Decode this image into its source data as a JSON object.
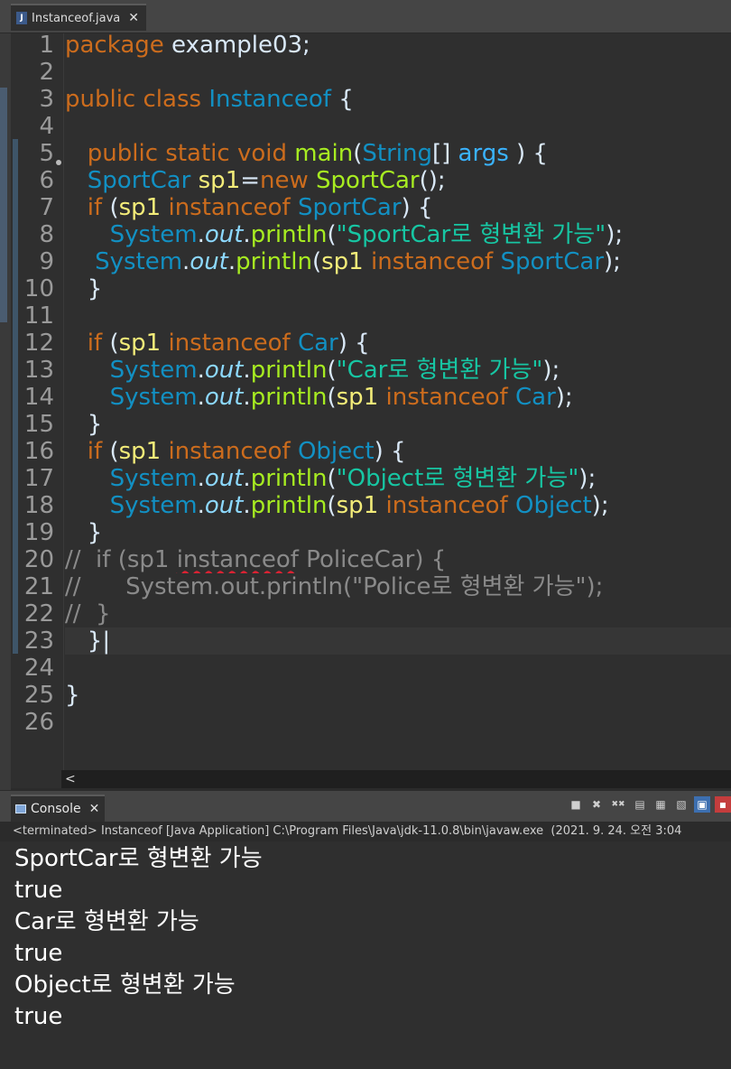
{
  "editor": {
    "tab_label": "Instanceof.java",
    "file_icon": "J",
    "lines": [
      {
        "n": "1",
        "tokens": [
          [
            "kw",
            "package "
          ],
          [
            "",
            "example03;"
          ]
        ]
      },
      {
        "n": "2",
        "tokens": []
      },
      {
        "n": "3",
        "tokens": [
          [
            "kw",
            "public "
          ],
          [
            "kw",
            "class "
          ],
          [
            "cls",
            "Instanceof"
          ],
          [
            "",
            " {"
          ]
        ]
      },
      {
        "n": "4",
        "tokens": []
      },
      {
        "n": "5",
        "tokens": [
          [
            "",
            "   "
          ],
          [
            "kw",
            "public "
          ],
          [
            "kw",
            "static "
          ],
          [
            "kw",
            "void "
          ],
          [
            "fn",
            "main"
          ],
          [
            "",
            "("
          ],
          [
            "cls",
            "String"
          ],
          [
            "",
            "[] "
          ],
          [
            "fld",
            "args"
          ],
          [
            "",
            " ) {"
          ]
        ]
      },
      {
        "n": "6",
        "tokens": [
          [
            "",
            "   "
          ],
          [
            "cls",
            "SportCar "
          ],
          [
            "var",
            "sp1"
          ],
          [
            "",
            "="
          ],
          [
            "kw",
            "new "
          ],
          [
            "fn",
            "SportCar"
          ],
          [
            "",
            "();"
          ]
        ]
      },
      {
        "n": "7",
        "tokens": [
          [
            "",
            "   "
          ],
          [
            "kw",
            "if "
          ],
          [
            "",
            "("
          ],
          [
            "var",
            "sp1 "
          ],
          [
            "kw",
            "instanceof "
          ],
          [
            "cls",
            "SportCar"
          ],
          [
            "",
            ") {"
          ]
        ]
      },
      {
        "n": "8",
        "tokens": [
          [
            "",
            "      "
          ],
          [
            "cls",
            "System"
          ],
          [
            "",
            "."
          ],
          [
            "out",
            "out"
          ],
          [
            "",
            "."
          ],
          [
            "fn",
            "println"
          ],
          [
            "",
            "("
          ],
          [
            "str",
            "\"SportCar로 형변환 가능\""
          ],
          [
            "",
            ");"
          ]
        ]
      },
      {
        "n": "9",
        "tokens": [
          [
            "",
            "    "
          ],
          [
            "cls",
            "System"
          ],
          [
            "",
            "."
          ],
          [
            "out",
            "out"
          ],
          [
            "",
            "."
          ],
          [
            "fn",
            "println"
          ],
          [
            "",
            "("
          ],
          [
            "var",
            "sp1 "
          ],
          [
            "kw",
            "instanceof "
          ],
          [
            "cls",
            "SportCar"
          ],
          [
            "",
            ");"
          ]
        ]
      },
      {
        "n": "10",
        "tokens": [
          [
            "",
            "   }"
          ]
        ]
      },
      {
        "n": "11",
        "tokens": []
      },
      {
        "n": "12",
        "tokens": [
          [
            "",
            "   "
          ],
          [
            "kw",
            "if "
          ],
          [
            "",
            "("
          ],
          [
            "var",
            "sp1 "
          ],
          [
            "kw",
            "instanceof "
          ],
          [
            "cls",
            "Car"
          ],
          [
            "",
            ") {"
          ]
        ]
      },
      {
        "n": "13",
        "tokens": [
          [
            "",
            "      "
          ],
          [
            "cls",
            "System"
          ],
          [
            "",
            "."
          ],
          [
            "out",
            "out"
          ],
          [
            "",
            "."
          ],
          [
            "fn",
            "println"
          ],
          [
            "",
            "("
          ],
          [
            "str",
            "\"Car로 형변환 가능\""
          ],
          [
            "",
            ");"
          ]
        ]
      },
      {
        "n": "14",
        "tokens": [
          [
            "",
            "      "
          ],
          [
            "cls",
            "System"
          ],
          [
            "",
            "."
          ],
          [
            "out",
            "out"
          ],
          [
            "",
            "."
          ],
          [
            "fn",
            "println"
          ],
          [
            "",
            "("
          ],
          [
            "var",
            "sp1 "
          ],
          [
            "kw",
            "instanceof "
          ],
          [
            "cls",
            "Car"
          ],
          [
            "",
            ");"
          ]
        ]
      },
      {
        "n": "15",
        "tokens": [
          [
            "",
            "   }"
          ]
        ]
      },
      {
        "n": "16",
        "tokens": [
          [
            "",
            "   "
          ],
          [
            "kw",
            "if "
          ],
          [
            "",
            "("
          ],
          [
            "var",
            "sp1 "
          ],
          [
            "kw",
            "instanceof "
          ],
          [
            "cls",
            "Object"
          ],
          [
            "",
            ") {"
          ]
        ]
      },
      {
        "n": "17",
        "tokens": [
          [
            "",
            "      "
          ],
          [
            "cls",
            "System"
          ],
          [
            "",
            "."
          ],
          [
            "out",
            "out"
          ],
          [
            "",
            "."
          ],
          [
            "fn",
            "println"
          ],
          [
            "",
            "("
          ],
          [
            "str",
            "\"Object로 형변환 가능\""
          ],
          [
            "",
            ");"
          ]
        ]
      },
      {
        "n": "18",
        "tokens": [
          [
            "",
            "      "
          ],
          [
            "cls",
            "System"
          ],
          [
            "",
            "."
          ],
          [
            "out",
            "out"
          ],
          [
            "",
            "."
          ],
          [
            "fn",
            "println"
          ],
          [
            "",
            "("
          ],
          [
            "var",
            "sp1 "
          ],
          [
            "kw",
            "instanceof "
          ],
          [
            "cls",
            "Object"
          ],
          [
            "",
            ");"
          ]
        ]
      },
      {
        "n": "19",
        "tokens": [
          [
            "",
            "   }"
          ]
        ]
      },
      {
        "n": "20",
        "tokens": [
          [
            "cm",
            "//  if (sp1 "
          ],
          [
            "cm wavy",
            "instanceof"
          ],
          [
            "cm",
            " PoliceCar) {"
          ]
        ]
      },
      {
        "n": "21",
        "tokens": [
          [
            "cm",
            "//      System.out.println(\"Police로 형변환 가능\");"
          ]
        ]
      },
      {
        "n": "22",
        "tokens": [
          [
            "cm",
            "//  }"
          ]
        ]
      },
      {
        "n": "23",
        "tokens": [
          [
            "",
            "   }|"
          ]
        ]
      },
      {
        "n": "24",
        "tokens": []
      },
      {
        "n": "25",
        "tokens": [
          [
            "",
            "}"
          ]
        ]
      },
      {
        "n": "26",
        "tokens": []
      }
    ],
    "current_line": "23",
    "scroll_left_arrow": "<"
  },
  "console": {
    "tab_label": "Console",
    "status": "<terminated> Instanceof [Java Application] C:\\Program Files\\Java\\jdk-11.0.8\\bin\\javaw.exe  (2021. 9. 24. 오전 3:04",
    "output": [
      "SportCar로 형변환 가능",
      "true",
      "Car로 형변환 가능",
      "true",
      "Object로 형변환 가능",
      "true"
    ],
    "toolbar_icons": [
      "stop-icon",
      "remove-launch-icon",
      "remove-all-icon",
      "clear-console-icon",
      "scroll-lock-icon",
      "word-wrap-icon",
      "pin-console-icon",
      "display-selected-console-icon"
    ]
  },
  "icons": {
    "close": "✕",
    "stop": "■",
    "remove": "✖",
    "remove_all": "✖✖"
  }
}
